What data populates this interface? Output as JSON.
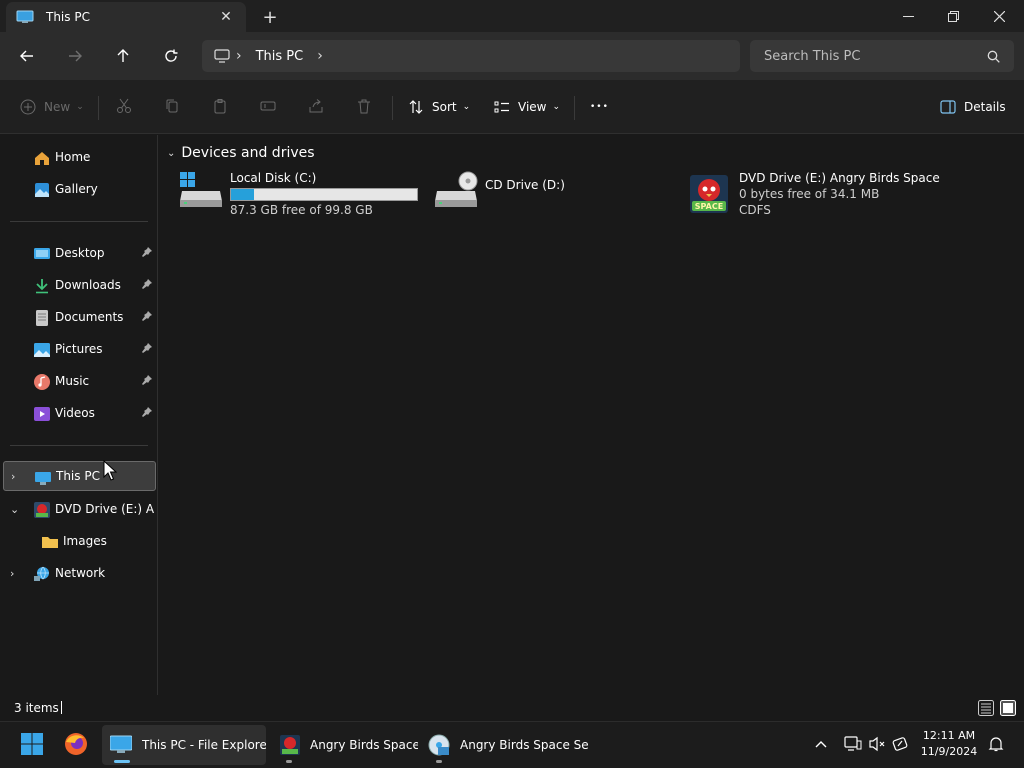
{
  "window": {
    "tab_title": "This PC",
    "close_tab_glyph": "✕",
    "new_tab_glyph": "+",
    "minimize_glyph": "—",
    "maximize_glyph": "❐",
    "close_glyph": "✕"
  },
  "address": {
    "segments": [
      "This PC"
    ],
    "search_placeholder": "Search This PC"
  },
  "commands": {
    "new_label": "New",
    "sort_label": "Sort",
    "view_label": "View",
    "more_glyph": "•••",
    "details_label": "Details"
  },
  "sidebar": {
    "home": "Home",
    "gallery": "Gallery",
    "pinned": [
      {
        "label": "Desktop",
        "icon": "desktop-icon"
      },
      {
        "label": "Downloads",
        "icon": "downloads-icon"
      },
      {
        "label": "Documents",
        "icon": "documents-icon"
      },
      {
        "label": "Pictures",
        "icon": "pictures-icon"
      },
      {
        "label": "Music",
        "icon": "music-icon"
      },
      {
        "label": "Videos",
        "icon": "videos-icon"
      }
    ],
    "this_pc": "This PC",
    "dvd_drive": "DVD Drive (E:) Angry Birds Space",
    "images": "Images",
    "network": "Network",
    "pin_glyph": "📌"
  },
  "main": {
    "group_title": "Devices and drives",
    "drives": [
      {
        "name": "Local Disk (C:)",
        "detail": "87.3 GB free of 99.8 GB",
        "used_fraction": 0.125
      },
      {
        "name": "CD Drive (D:)"
      },
      {
        "name": "DVD Drive (E:) Angry Birds Space",
        "detail": "0 bytes free of 34.1 MB",
        "fs": "CDFS",
        "icon_text": "SPACE"
      }
    ]
  },
  "status": {
    "item_count": "3 items"
  },
  "taskbar": {
    "apps": [
      {
        "label": "This PC - File Explorer"
      },
      {
        "label": "Angry Birds Space"
      },
      {
        "label": "Angry Birds Space Setup"
      }
    ],
    "time": "12:11 AM",
    "date": "11/9/2024"
  },
  "colors": {
    "accent": "#26a0da",
    "window_bg": "#191919",
    "toolbar_bg": "#2c2c2c"
  }
}
